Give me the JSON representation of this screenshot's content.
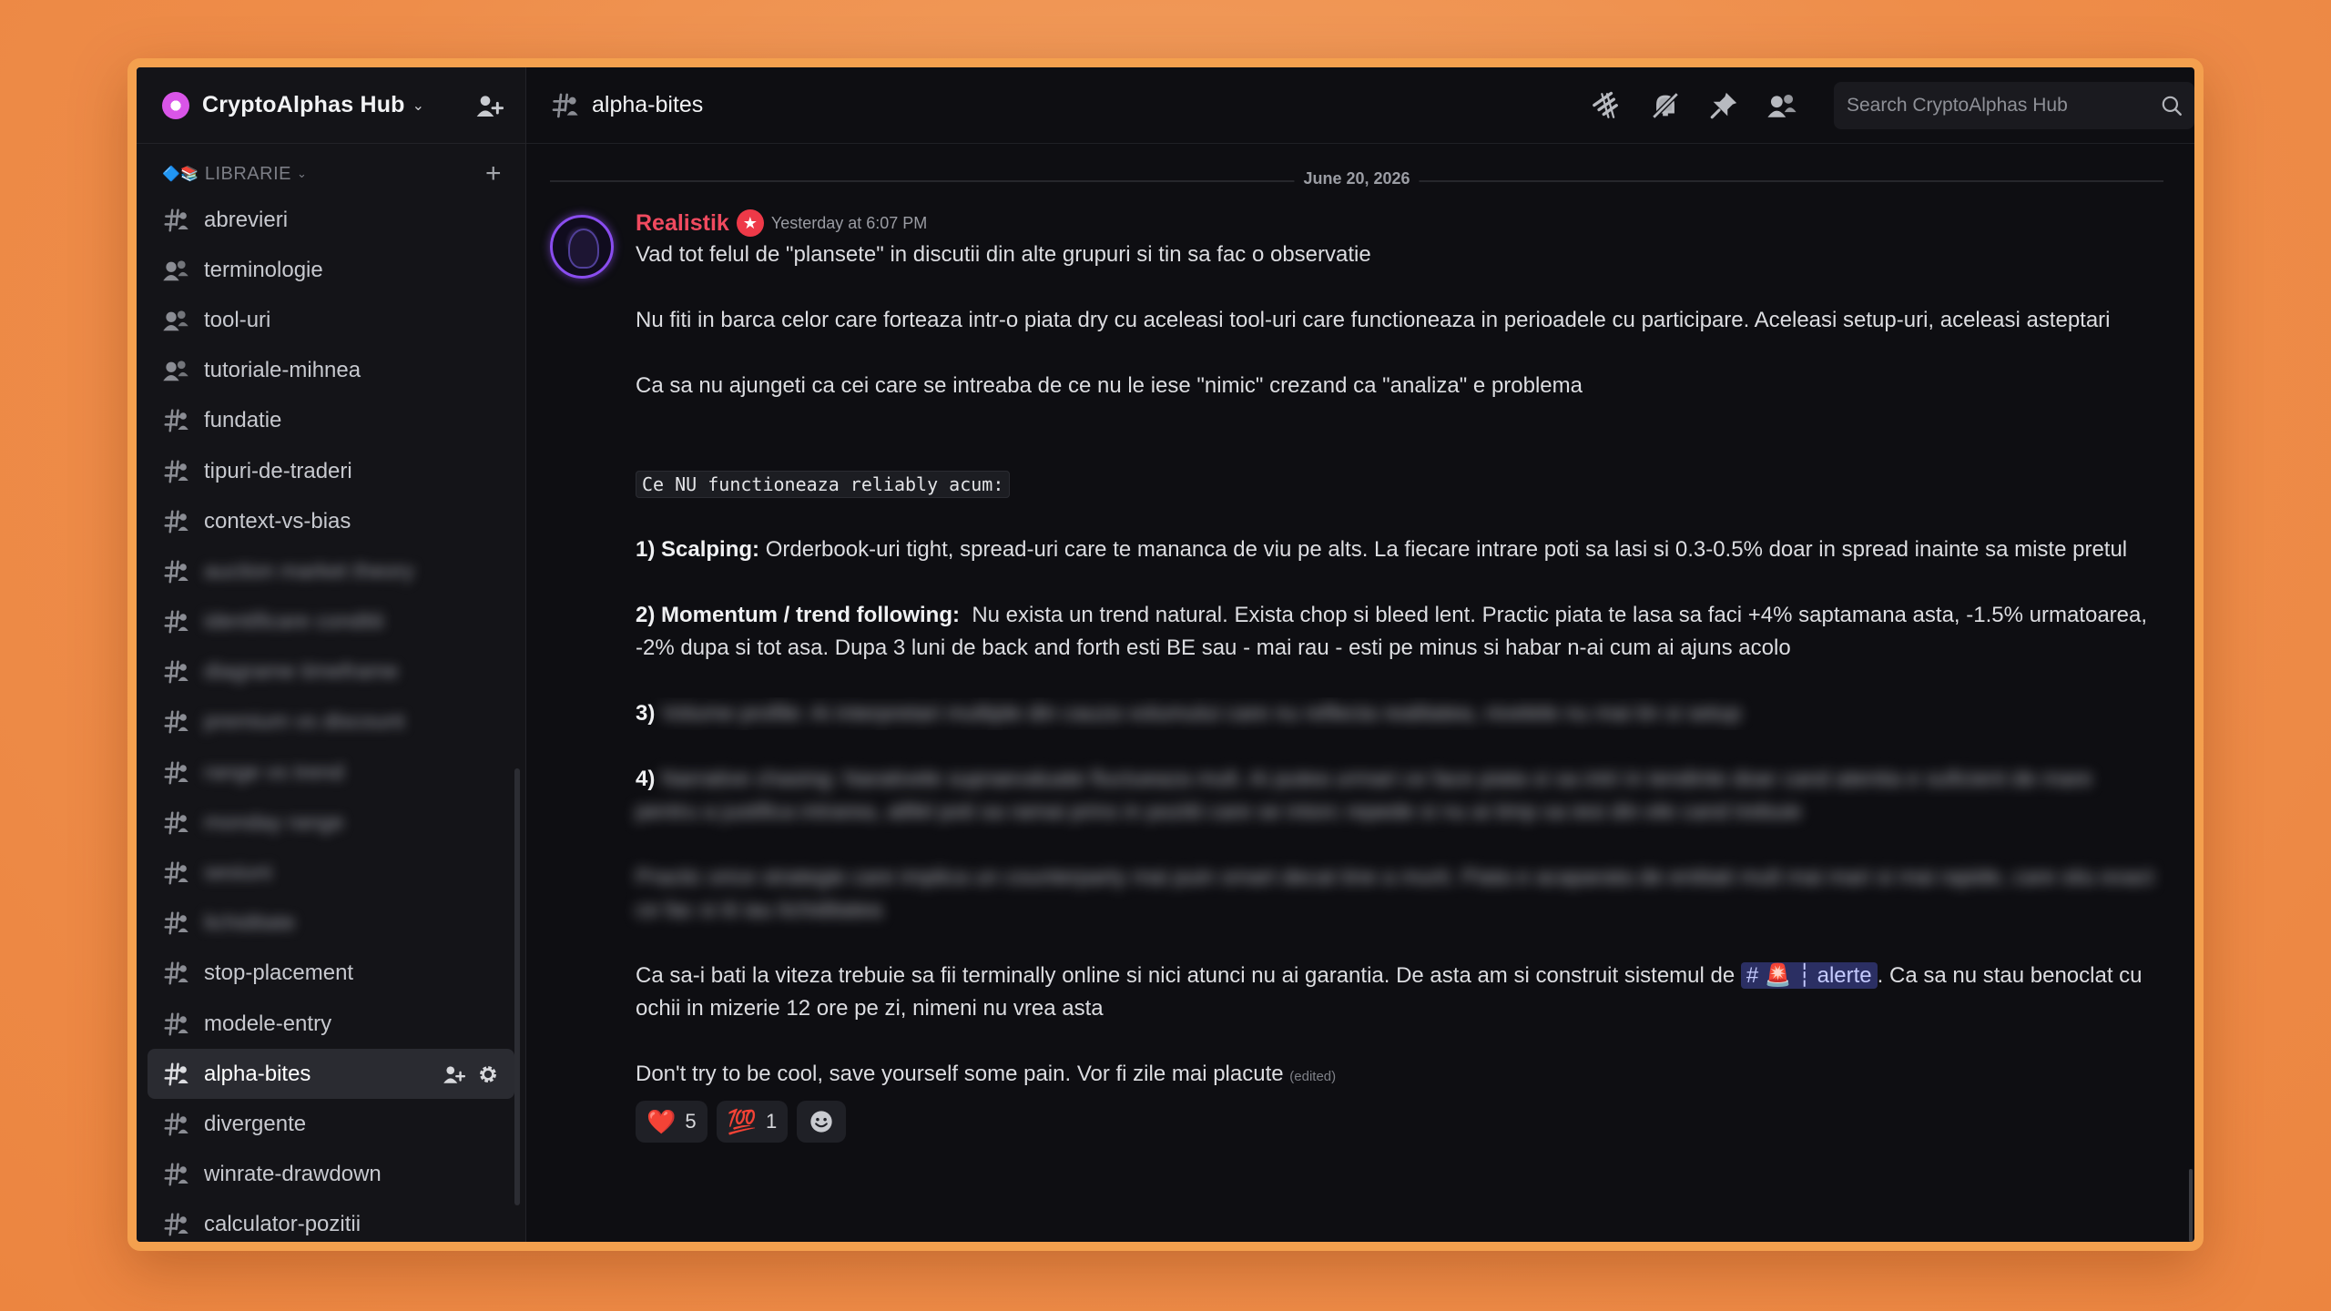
{
  "server": {
    "name": "CryptoAlphas Hub"
  },
  "category": {
    "label": "LIBRARIE",
    "emoji": "🔷📚"
  },
  "channels": [
    {
      "label": "abrevieri",
      "blurred": false
    },
    {
      "label": "terminologie",
      "blurred": false
    },
    {
      "label": "tool-uri",
      "blurred": false
    },
    {
      "label": "tutoriale-mihnea",
      "blurred": false
    },
    {
      "label": "fundatie",
      "blurred": false
    },
    {
      "label": "tipuri-de-traderi",
      "blurred": false
    },
    {
      "label": "context-vs-bias",
      "blurred": false
    },
    {
      "label": "auction market theory",
      "blurred": true
    },
    {
      "label": "identificare conditii",
      "blurred": true
    },
    {
      "label": "diagrame timeframe",
      "blurred": true
    },
    {
      "label": "premium vs discount",
      "blurred": true
    },
    {
      "label": "range vs trend",
      "blurred": true
    },
    {
      "label": "monday range",
      "blurred": true
    },
    {
      "label": "sesiuni",
      "blurred": true
    },
    {
      "label": "lichiditate",
      "blurred": true
    },
    {
      "label": "stop-placement",
      "blurred": false
    },
    {
      "label": "modele-entry",
      "blurred": false
    },
    {
      "label": "alpha-bites",
      "blurred": false,
      "active": true
    },
    {
      "label": "divergente",
      "blurred": false
    },
    {
      "label": "winrate-drawdown",
      "blurred": false
    },
    {
      "label": "calculator-pozitii",
      "blurred": false
    }
  ],
  "topbar": {
    "channel": "alpha-bites",
    "search_placeholder": "Search CryptoAlphas Hub"
  },
  "date_divider": "June 20, 2026",
  "message": {
    "author": "Realistik",
    "timestamp": "Yesterday at 6:07 PM",
    "p1": "Vad tot felul de \"plansete\" in discutii din alte grupuri si tin sa fac o observatie",
    "p2": "Nu fiti in barca celor care forteaza intr-o piata dry cu aceleasi tool-uri care functioneaza in perioadele cu participare. Aceleasi setup-uri, aceleasi asteptari",
    "p3": "Ca sa nu ajungeti ca cei care se intreaba de ce nu le iese \"nimic\" crezand ca \"analiza\" e problema",
    "code": "Ce NU functioneaza reliably acum:",
    "item1_title": "1) Scalping:",
    "item1_text": "Orderbook-uri tight, spread-uri care te mananca de viu pe alts. La fiecare intrare poti sa lasi si 0.3-0.5% doar in spread inainte sa miste pretul",
    "item2_title": "2) Momentum / trend following:",
    "item2_text": "Nu exista un trend natural. Exista chop si bleed lent. Practic piata te lasa sa faci +4% saptamana asta, -1.5% urmatoarea, -2% dupa si tot asa. Dupa 3 luni de back and forth esti BE sau - mai rau - esti pe minus si habar n-ai cum ai ajuns acolo",
    "item3_num": "3)",
    "item3_blur": "Volume profile: Ai interpretari multiple din cauza volumului care nu reflecta realitatea, nivelele nu mai tin si setup",
    "item4_num": "4)",
    "item4_blur": "Narrative chasing: Narativele supraevaluate fluctueaza mult. Ai putea urmari ce face piata si sa intri in tendinte doar cand atentia e suficient de mare pentru a justifica intrarea, altfel poti sa ramai prins in pozitii care se intorc repede si nu ai timp sa iesi din ele cand trebuie",
    "p_blur": "Practic orice strategie care implica un counterparty mai puin smart decat tine a murit. Piata e acaparata de entitati mult mai mari si mai rapide, care stiu exact ce fac si iti iau lichiditatea",
    "p_alert_before": "Ca sa-i bati la viteza trebuie sa fii terminally online si nici atunci nu ai garantia. De asta am si construit sistemul de",
    "mention_hash": "#",
    "mention_emoji": "🚨",
    "mention_sep": "┆",
    "mention_name": "alerte",
    "p_alert_after": ". Ca sa nu stau benoclat cu ochii in mizerie 12 ore pe zi, nimeni nu vrea asta",
    "p_last": "Don't try to be cool, save yourself some pain. Vor fi zile mai placute",
    "edited": "(edited)",
    "reactions": [
      {
        "emoji": "❤️",
        "count": "5"
      },
      {
        "emoji": "💯",
        "count": "1"
      }
    ]
  },
  "colors": {
    "accent_author": "#f04a5f",
    "window_border": "#f4a04e",
    "background": "#ec8540"
  }
}
